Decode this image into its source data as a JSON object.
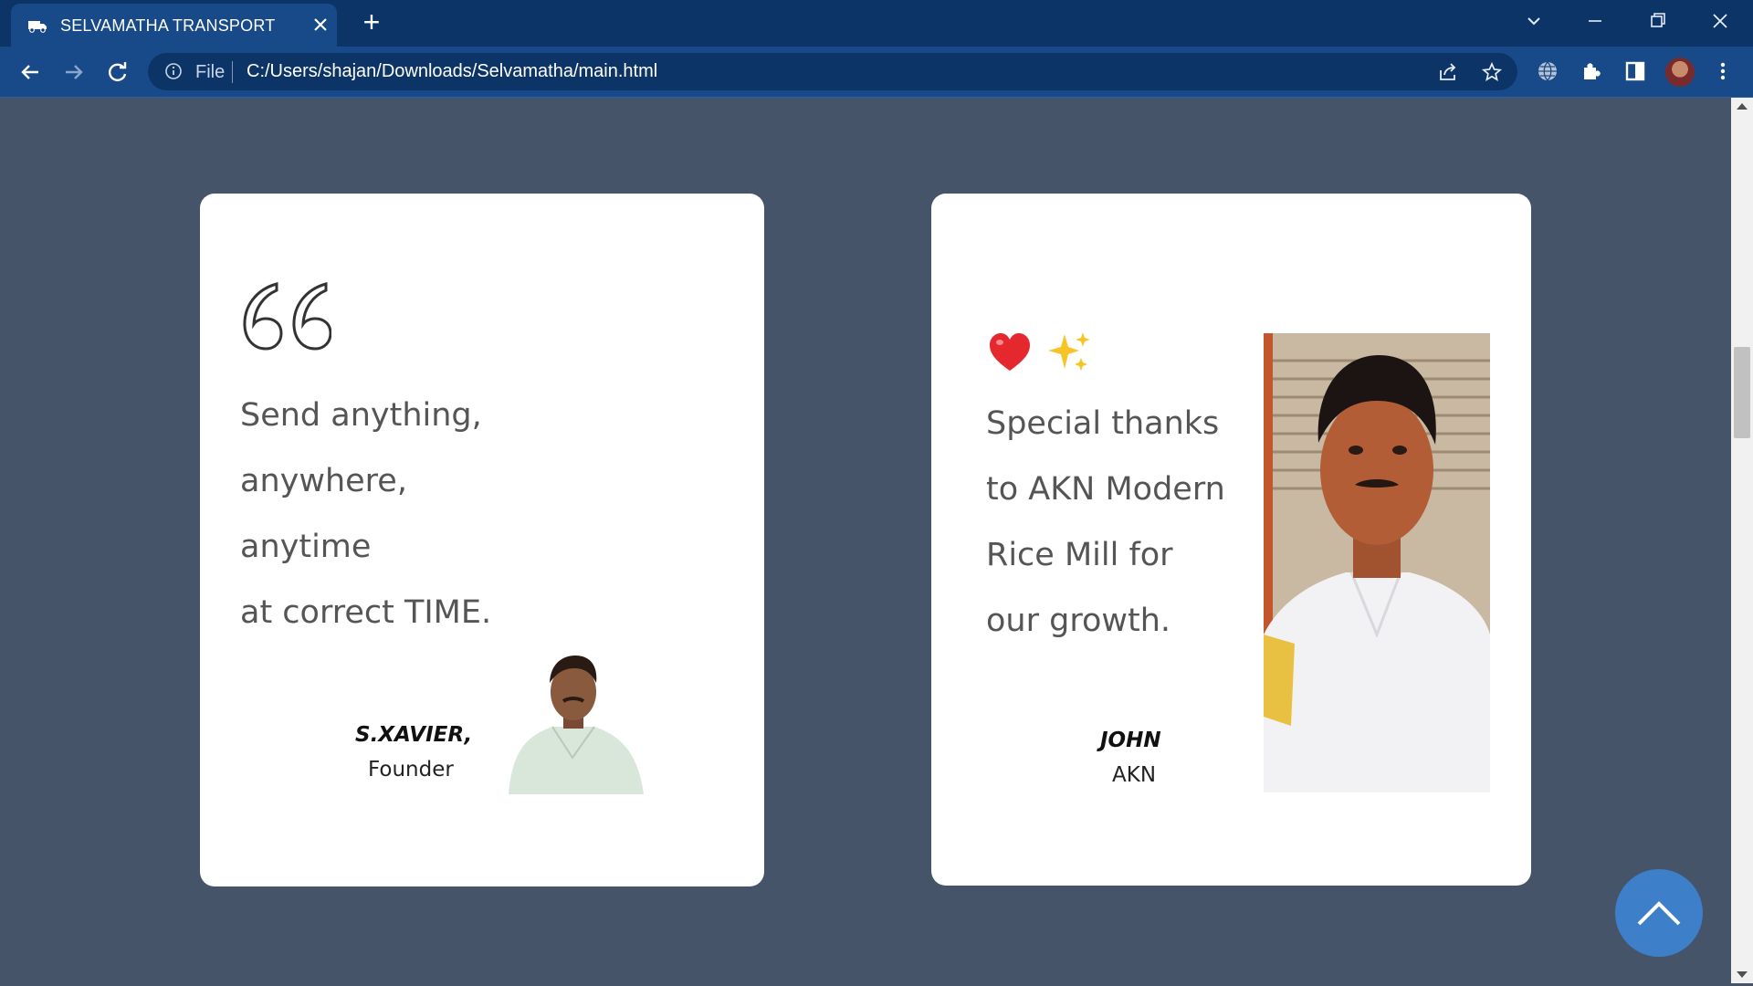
{
  "browser": {
    "tab_title": "SELVAMATHA TRANSPORT",
    "new_tab_symbol": "+",
    "address_scheme": "File",
    "address_url": "C:/Users/shajan/Downloads/Selvamatha/main.html"
  },
  "testimonials": [
    {
      "quote_lines": [
        "Send anything,",
        "anywhere,",
        "anytime",
        "at correct TIME."
      ],
      "name": "S.XAVIER,",
      "role": "Founder"
    },
    {
      "quote_lines": [
        "Special thanks",
        "to AKN Modern",
        "Rice Mill for",
        "our growth."
      ],
      "name": "JOHN",
      "role": "AKN"
    }
  ],
  "colors": {
    "page_background": "#455468",
    "card_background": "#ffffff",
    "back_to_top": "#3d7fc8",
    "chrome_title": "#0d3466",
    "chrome_toolbar": "#184a8a"
  },
  "icons": {
    "quote": "quote-icon",
    "heart": "heart-emoji",
    "sparkles": "sparkles-emoji",
    "back_to_top": "chevron-up-icon"
  }
}
